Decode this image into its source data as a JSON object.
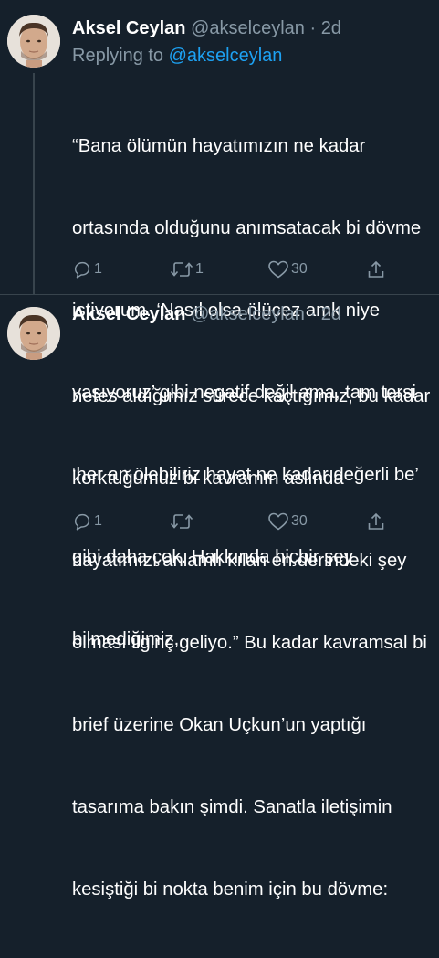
{
  "tweets": [
    {
      "name": "Aksel Ceylan",
      "handle": "@akselceylan",
      "separator": "·",
      "time": "2d",
      "replying_to_label": "Replying to",
      "replying_to_handle": "@akselceylan",
      "lines": [
        "“Bana ölümün hayatımızın ne kadar",
        "ortasında olduğunu anımsatacak bi dövme",
        "istiyorum. ‘Nasıl olsa ölücez amk niye",
        "yaşıyoruz’ gibi negatif değil ama, tam tersi",
        "‘her an ölebiliriz hayat ne kadar değerli be’",
        "gibi daha çok. Hakkında hiçbir şey",
        "bilmediğimiz,"
      ],
      "actions": {
        "reply_count": "1",
        "retweet_count": "1",
        "like_count": "30"
      }
    },
    {
      "name": "Aksel Ceylan",
      "handle": "@akselceylan",
      "separator": "·",
      "time": "2d",
      "lines": [
        "nefes aldığımız sürece kaçtığımız, bu kadar",
        "korktuğumuz bi kavramın aslında",
        "hayatımızı anlamlı kılan en derindeki şey",
        "olması ilginç geliyo.” Bu kadar kavramsal bi",
        "brief üzerine Okan Uçkun’un yaptığı",
        "tasarıma bakın şimdi. Sanatla iletişimin",
        "kesiştiği bi nokta benim için bu dövme:"
      ],
      "actions": {
        "reply_count": "1",
        "retweet_count": "",
        "like_count": "30"
      }
    }
  ],
  "colors": {
    "background": "#15202b",
    "secondary_text": "#8899a6",
    "mention": "#1da1f2",
    "divider": "#38444d"
  }
}
